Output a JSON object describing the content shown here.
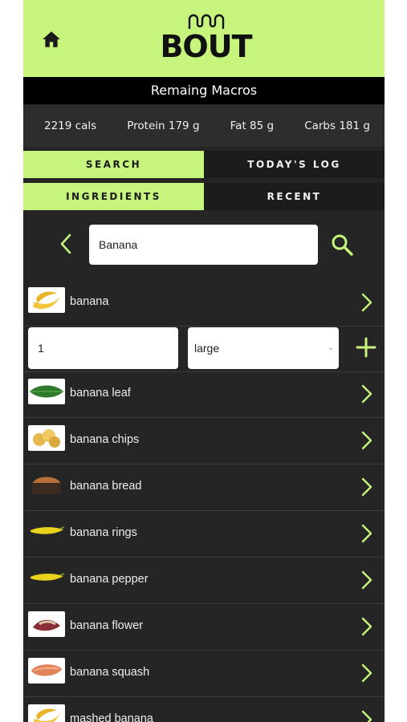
{
  "header": {
    "logo_text": "BOUT"
  },
  "macros": {
    "title": "Remaing Macros",
    "calories": "2219 cals",
    "protein": "Protein 179 g",
    "fat": "Fat 85 g",
    "carbs": "Carbs 181 g"
  },
  "tabs_main": [
    {
      "label": "SEARCH",
      "active": true
    },
    {
      "label": "TODAY'S LOG",
      "active": false
    }
  ],
  "tabs_sub": [
    {
      "label": "INGREDIENTS",
      "active": true
    },
    {
      "label": "RECENT",
      "active": false
    }
  ],
  "search": {
    "value": "Banana"
  },
  "quantity": {
    "amount": "1",
    "unit": "large"
  },
  "results": [
    {
      "label": "banana",
      "thumb": "banana-icon"
    },
    {
      "label": "banana leaf",
      "thumb": "banana-leaf-icon"
    },
    {
      "label": "banana chips",
      "thumb": "banana-chips-icon"
    },
    {
      "label": "banana bread",
      "thumb": "banana-bread-icon"
    },
    {
      "label": "banana rings",
      "thumb": "banana-rings-icon"
    },
    {
      "label": "banana pepper",
      "thumb": "banana-pepper-icon"
    },
    {
      "label": "banana flower",
      "thumb": "banana-flower-icon"
    },
    {
      "label": "banana squash",
      "thumb": "banana-squash-icon"
    },
    {
      "label": "mashed banana",
      "thumb": "mashed-banana-icon"
    }
  ],
  "colors": {
    "accent": "#c6f47c",
    "panel": "#252525",
    "dark_tab": "#1c1c1c"
  }
}
